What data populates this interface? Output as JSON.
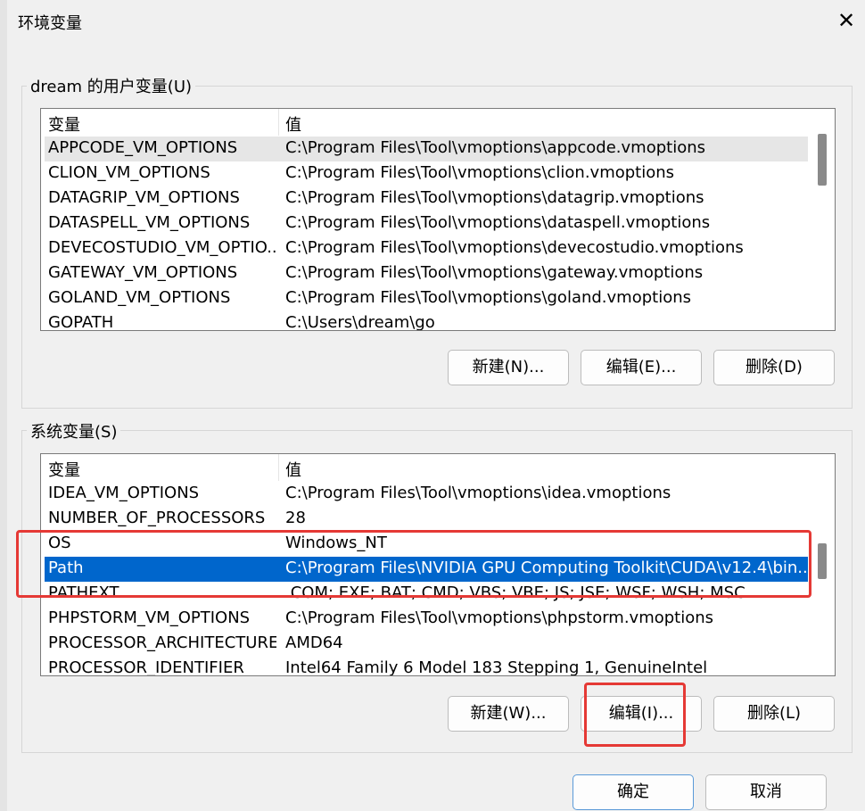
{
  "window": {
    "title": "环境变量",
    "close_glyph": "✕"
  },
  "user_vars": {
    "label": "dream 的用户变量(U)",
    "columns": [
      "变量",
      "值"
    ],
    "rows": [
      {
        "name": "APPCODE_VM_OPTIONS",
        "value": "C:\\Program Files\\Tool\\vmoptions\\appcode.vmoptions"
      },
      {
        "name": "CLION_VM_OPTIONS",
        "value": "C:\\Program Files\\Tool\\vmoptions\\clion.vmoptions"
      },
      {
        "name": "DATAGRIP_VM_OPTIONS",
        "value": "C:\\Program Files\\Tool\\vmoptions\\datagrip.vmoptions"
      },
      {
        "name": "DATASPELL_VM_OPTIONS",
        "value": "C:\\Program Files\\Tool\\vmoptions\\dataspell.vmoptions"
      },
      {
        "name": "DEVECOSTUDIO_VM_OPTIO...",
        "value": "C:\\Program Files\\Tool\\vmoptions\\devecostudio.vmoptions"
      },
      {
        "name": "GATEWAY_VM_OPTIONS",
        "value": "C:\\Program Files\\Tool\\vmoptions\\gateway.vmoptions"
      },
      {
        "name": "GOLAND_VM_OPTIONS",
        "value": "C:\\Program Files\\Tool\\vmoptions\\goland.vmoptions"
      },
      {
        "name": "GOPATH",
        "value": "C:\\Users\\dream\\go"
      }
    ],
    "buttons": {
      "new": "新建(N)...",
      "edit": "编辑(E)...",
      "delete": "删除(D)"
    }
  },
  "system_vars": {
    "label": "系统变量(S)",
    "columns": [
      "变量",
      "值"
    ],
    "rows": [
      {
        "name": "IDEA_VM_OPTIONS",
        "value": "C:\\Program Files\\Tool\\vmoptions\\idea.vmoptions"
      },
      {
        "name": "NUMBER_OF_PROCESSORS",
        "value": "28"
      },
      {
        "name": "OS",
        "value": "Windows_NT"
      },
      {
        "name": "Path",
        "value": "C:\\Program Files\\NVIDIA GPU Computing Toolkit\\CUDA\\v12.4\\bin..."
      },
      {
        "name": "PATHEXT",
        "value": ".COM;.EXE;.BAT;.CMD;.VBS;.VBE;.JS;.JSE;.WSF;.WSH;.MSC"
      },
      {
        "name": "PHPSTORM_VM_OPTIONS",
        "value": "C:\\Program Files\\Tool\\vmoptions\\phpstorm.vmoptions"
      },
      {
        "name": "PROCESSOR_ARCHITECTURE",
        "value": "AMD64"
      },
      {
        "name": "PROCESSOR_IDENTIFIER",
        "value": "Intel64 Family 6 Model 183 Stepping 1, GenuineIntel"
      }
    ],
    "buttons": {
      "new": "新建(W)...",
      "edit": "编辑(I)...",
      "delete": "删除(L)"
    }
  },
  "footer": {
    "ok": "确定",
    "cancel": "取消"
  },
  "colors": {
    "selection": "#0066cc",
    "highlight_box": "#e53935"
  }
}
